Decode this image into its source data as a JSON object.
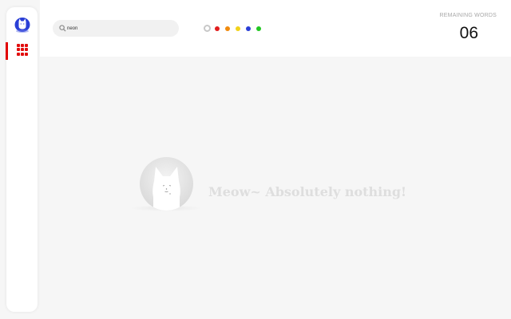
{
  "search": {
    "value": "neon",
    "placeholder": ""
  },
  "color_filters": [
    {
      "name": "all",
      "color": "#ffffff"
    },
    {
      "name": "red",
      "color": "#e11d1d"
    },
    {
      "name": "orange",
      "color": "#f08a0c"
    },
    {
      "name": "yellow",
      "color": "#f2d21a"
    },
    {
      "name": "blue",
      "color": "#2a3fd6"
    },
    {
      "name": "green",
      "color": "#22c722"
    }
  ],
  "remaining": {
    "label": "REMAINING WORDS",
    "count": "06"
  },
  "empty_state": {
    "message": "Meow~ Absolutely nothing!"
  },
  "theme": {
    "accent": "#e10000",
    "logo_color": "#2a3fd6"
  }
}
